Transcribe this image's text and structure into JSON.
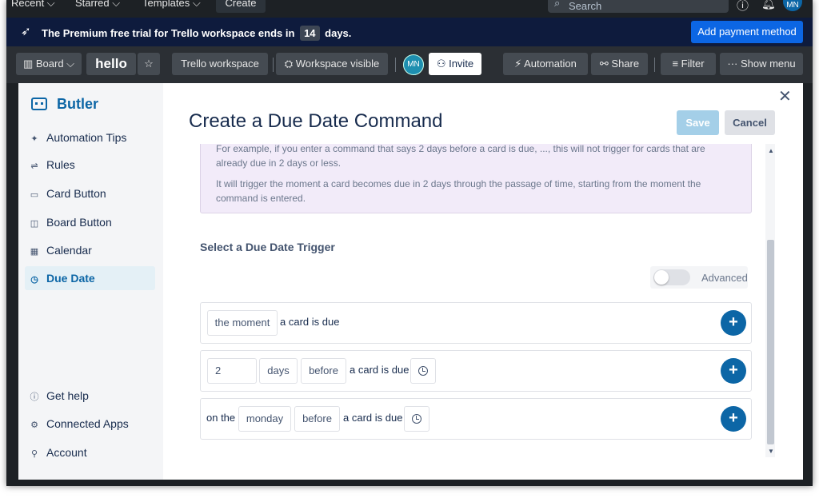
{
  "topnav": {
    "recent": "Recent ⌵",
    "starred": "Starred ⌵",
    "templates": "Templates ⌵",
    "create": "Create",
    "search_placeholder": "Search",
    "avatar_initials": "MN"
  },
  "banner": {
    "message_before": "The Premium free trial for Trello workspace ends in",
    "days": "14",
    "message_after": "days.",
    "pay_button": "Add payment method"
  },
  "boardbar": {
    "board_label": "Board ⌵",
    "board_name": "hello",
    "workspace": "Trello workspace",
    "visibility": "Workspace visible",
    "member_initials": "MN",
    "invite": "Invite",
    "automation": "Automation",
    "share": "Share",
    "filter": "Filter",
    "show_menu": "Show menu"
  },
  "sidebar": {
    "brand": "Butler",
    "items": [
      {
        "label": "Automation Tips",
        "icon": "sparkle-icon"
      },
      {
        "label": "Rules",
        "icon": "rules-icon"
      },
      {
        "label": "Card Button",
        "icon": "card-icon"
      },
      {
        "label": "Board Button",
        "icon": "board-icon"
      },
      {
        "label": "Calendar",
        "icon": "calendar-icon"
      },
      {
        "label": "Due Date",
        "icon": "clock-icon",
        "active": true
      }
    ],
    "bottom_items": [
      {
        "label": "Get help",
        "icon": "info-icon"
      },
      {
        "label": "Connected Apps",
        "icon": "gear-icon"
      },
      {
        "label": "Account",
        "icon": "person-icon"
      }
    ]
  },
  "main": {
    "title": "Create a Due Date Command",
    "save": "Save",
    "cancel": "Cancel",
    "info_p1": "For example, if you enter a command that says 2 days before a card is due, ..., this will not trigger for cards that are already due in 2 days or less.",
    "info_p2": "It will trigger the moment a card becomes due in 2 days through the passage of time, starting from the moment the command is entered.",
    "section_title": "Select a Due Date Trigger",
    "advanced_label": "Advanced",
    "advanced_on": false
  },
  "triggers": {
    "t1": {
      "pill": "the moment",
      "text": "a card is due"
    },
    "t2": {
      "number": "2",
      "unit": "days",
      "relation": "before",
      "text": "a card is due"
    },
    "t3": {
      "prefix": "on the",
      "day": "monday",
      "relation": "before",
      "text": "a card is due"
    }
  },
  "colors": {
    "accent": "#0c66a6",
    "banner_bg": "#0e1b3d",
    "info_bg": "#f2ebf9",
    "pay_button": "#0c66e4"
  }
}
